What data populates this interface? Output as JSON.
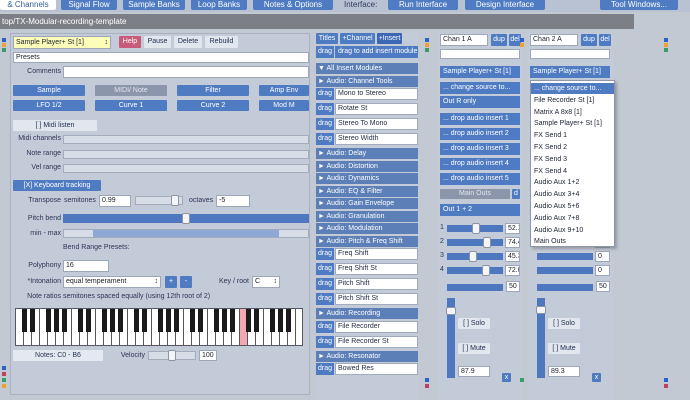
{
  "top_tabs": {
    "channels": "& Channels",
    "signal_flow": "Signal Flow",
    "sample_banks": "Sample Banks",
    "loop_banks": "Loop Banks",
    "notes_options": "Notes & Options",
    "interface_label": "Interface:",
    "run_interface": "Run Interface",
    "design_interface": "Design Interface",
    "tool_windows": "Tool Windows..."
  },
  "path_bar": "top/TX-Modular-recording-template",
  "left_panel": {
    "module_select": "Sample Player+ St [1]",
    "help": "Help",
    "pause": "Pause",
    "delete": "Delete",
    "rebuild": "Rebuild",
    "presets": "Presets",
    "comments_label": "Comments",
    "tabs": [
      "Sample",
      "MIDI/ Note",
      "Filter",
      "Amp Env"
    ],
    "tabs2": [
      "LFO 1/2",
      "Curve 1",
      "Curve 2",
      "Mod M"
    ],
    "midi_listen": "[  ] Midi listen",
    "midi_channels": "Midi channels",
    "note_range": "Note range",
    "vel_range": "Vel range",
    "keyboard_tracking": "[X] Keyboard tracking",
    "transpose_label": "Transpose",
    "semitones_label": "semitones",
    "semitones_value": "0.99",
    "octaves_label": "octaves",
    "octaves_value": "-5",
    "pitch_bend_label": "Pitch bend",
    "min_max_label": "min - max",
    "bend_range_presets": "Bend Range Presets:",
    "polyphony_label": "Polyphony",
    "polyphony_value": "16",
    "intonation_label": "*Intonation",
    "intonation_value": "equal temperament",
    "plus": "+",
    "minus": "-",
    "key_root_label": "Key / root",
    "key_root_value": "C",
    "note_ratios_label": "Note ratios",
    "note_ratios_value": "semitones spaced equally (using 12th root of 2)",
    "notes_range": "Notes: C0 - B6",
    "velocity_label": "Velocity",
    "velocity_value": "100"
  },
  "insert_column": {
    "titles": "Titles",
    "add_channel": "+Channel",
    "add_insert": "+Insert",
    "drag_hint": "drag to add insert module",
    "drag": "drag",
    "rows": [
      {
        "type": "head",
        "label": "▼ All Insert Modules"
      },
      {
        "type": "head",
        "label": "► Audio: Channel Tools"
      },
      {
        "type": "item",
        "label": "Mono to Stereo"
      },
      {
        "type": "item",
        "label": "Rotate St"
      },
      {
        "type": "item",
        "label": "Stereo To Mono"
      },
      {
        "type": "item",
        "label": "Stereo Width"
      },
      {
        "type": "head",
        "label": "► Audio: Delay"
      },
      {
        "type": "head",
        "label": "► Audio: Distortion"
      },
      {
        "type": "head",
        "label": "► Audio: Dynamics"
      },
      {
        "type": "head",
        "label": "► Audio: EQ & Filter"
      },
      {
        "type": "head",
        "label": "► Audio: Gain Envelope"
      },
      {
        "type": "head",
        "label": "► Audio: Granulation"
      },
      {
        "type": "head",
        "label": "► Audio: Modulation"
      },
      {
        "type": "head",
        "label": "► Audio: Pitch & Freq Shift"
      },
      {
        "type": "item",
        "label": "Freq Shift"
      },
      {
        "type": "item",
        "label": "Freq Shift St"
      },
      {
        "type": "item",
        "label": "Pitch Shift"
      },
      {
        "type": "item",
        "label": "Pitch Shift St"
      },
      {
        "type": "head",
        "label": "► Audio: Recording"
      },
      {
        "type": "item",
        "label": "File Recorder"
      },
      {
        "type": "item",
        "label": "File Recorder St"
      },
      {
        "type": "head",
        "label": "► Audio: Resonator"
      },
      {
        "type": "item",
        "label": "Bowed Res"
      }
    ]
  },
  "chan1": {
    "name": "Chan 1 A",
    "dup": "dup",
    "del": "del",
    "source": "Sample Player+ St [1]",
    "change_source": "... change source to...",
    "out_mode": "Out R only",
    "inserts": [
      "... drop audio insert 1",
      "... drop audio insert 2",
      "... drop audio insert 3",
      "... drop audio insert 4",
      "... drop audio insert 5"
    ],
    "main_outs": "Main Outs",
    "d": "d",
    "out_pair": "Out 1 + 2",
    "sends": [
      {
        "num": "1",
        "value": "52.1"
      },
      {
        "num": "2",
        "value": "74.4"
      },
      {
        "num": "3",
        "value": "45.3"
      },
      {
        "num": "4",
        "value": "72.0"
      }
    ],
    "pan_value": "50",
    "solo": "[  ] Solo",
    "mute": "[  ] Mute",
    "level": "87.9",
    "x": "x"
  },
  "chan2": {
    "name": "Chan 2 A",
    "dup": "dup",
    "del": "del",
    "source": "Sample Player+ St [1]",
    "sends": [
      {
        "value": "0"
      },
      {
        "value": "0"
      },
      {
        "value": "0"
      },
      {
        "value": "0"
      }
    ],
    "pan_value": "50",
    "solo": "[  ] Solo",
    "mute": "[  ] Mute",
    "level": "89.3",
    "x": "x"
  },
  "dropdown": {
    "items": [
      "... change source to...",
      "File Recorder St [1]",
      "Matrix A 8x8 [1]",
      "Sample Player+ St [1]",
      "FX Send 1",
      "FX Send 2",
      "FX Send 3",
      "FX Send 4",
      "Audio Aux 1+2",
      "Audio Aux 3+4",
      "Audio Aux 5+6",
      "Audio Aux 7+8",
      "Audio Aux 9+10",
      "Main Outs"
    ],
    "selected_index": 0
  },
  "controls": {
    "pitch_bend": 0.5,
    "min_max_low": 0.12,
    "min_max_high": 0.88,
    "velocity": 0.5,
    "chan1_sends": [
      0.52,
      0.74,
      0.45,
      0.72
    ],
    "chan1_level": 0.879,
    "chan2_level": 0.893
  },
  "colors": {
    "accent": "#4f7bc3",
    "help": "#c85a7a",
    "highlight_key": "#f2a9ad"
  }
}
